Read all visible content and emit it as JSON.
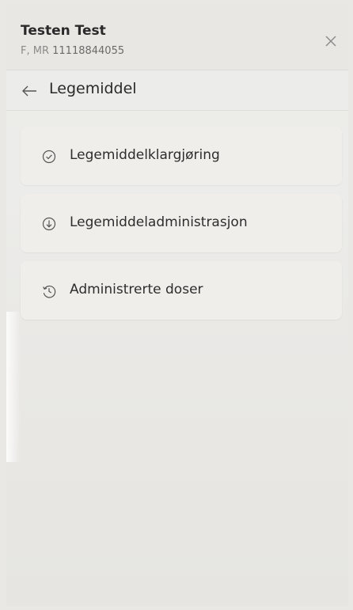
{
  "patient": {
    "name": "Testen Test",
    "id_prefix": "F, MR",
    "id_number": "11118844055"
  },
  "section": {
    "title": "Legemiddel"
  },
  "menu": {
    "items": [
      {
        "label": "Legemiddelklargjøring",
        "icon": "check-circle-icon"
      },
      {
        "label": "Legemiddeladministrasjon",
        "icon": "arrow-down-circle-icon"
      },
      {
        "label": "Administrerte doser",
        "icon": "history-icon"
      }
    ]
  }
}
